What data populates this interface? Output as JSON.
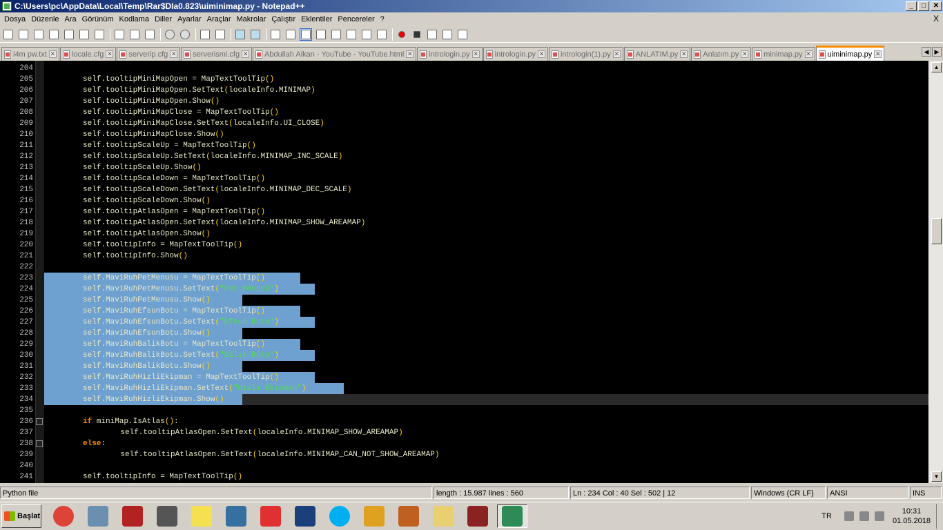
{
  "window": {
    "title": "C:\\Users\\pc\\AppData\\Local\\Temp\\Rar$DIa0.823\\uiminimap.py - Notepad++",
    "buttons": [
      "_",
      "□",
      "✕"
    ]
  },
  "menu": {
    "items": [
      "Dosya",
      "Düzenle",
      "Ara",
      "Görünüm",
      "Kodlama",
      "Diller",
      "Ayarlar",
      "Araçlar",
      "Makrolar",
      "Çalıştır",
      "Eklentiler",
      "Pencereler",
      "?"
    ],
    "close": "X"
  },
  "tabs": [
    {
      "label": "i4m pw.txt",
      "active": false
    },
    {
      "label": "locale.cfg",
      "active": false
    },
    {
      "label": "serverip.cfg",
      "active": false
    },
    {
      "label": "serverismi.cfg",
      "active": false
    },
    {
      "label": "Abdullah Alkan - YouTube - YouTube.html",
      "active": false
    },
    {
      "label": "introlo​gin.py",
      "active": false
    },
    {
      "label": "introlo​gin.py",
      "active": false
    },
    {
      "label": "introlo​gin(1).py",
      "active": false
    },
    {
      "label": "ANLATIM.py",
      "active": false
    },
    {
      "label": "Anlatım.py",
      "active": false
    },
    {
      "label": "minimap.py",
      "active": false
    },
    {
      "label": "uiminimap.py",
      "active": true
    }
  ],
  "editor": {
    "lines": [
      {
        "num": "204",
        "code": ""
      },
      {
        "num": "205",
        "code": "    self.tooltipMiniMapOpen = MapTextToolTip()"
      },
      {
        "num": "206",
        "code": "    self.tooltipMiniMapOpen.SetText(localeInfo.MINIMAP)"
      },
      {
        "num": "207",
        "code": "    self.tooltipMiniMapOpen.Show()"
      },
      {
        "num": "208",
        "code": "    self.tooltipMiniMapClose = MapTextToolTip()"
      },
      {
        "num": "209",
        "code": "    self.tooltipMiniMapClose.SetText(localeInfo.UI_CLOSE)"
      },
      {
        "num": "210",
        "code": "    self.tooltipMiniMapClose.Show()"
      },
      {
        "num": "211",
        "code": "    self.tooltipScaleUp = MapTextToolTip()"
      },
      {
        "num": "212",
        "code": "    self.tooltipScaleUp.SetText(localeInfo.MINIMAP_INC_SCALE)"
      },
      {
        "num": "213",
        "code": "    self.tooltipScaleUp.Show()"
      },
      {
        "num": "214",
        "code": "    self.tooltipScaleDown = MapTextToolTip()"
      },
      {
        "num": "215",
        "code": "    self.tooltipScaleDown.SetText(localeInfo.MINIMAP_DEC_SCALE)"
      },
      {
        "num": "216",
        "code": "    self.tooltipScaleDown.Show()"
      },
      {
        "num": "217",
        "code": "    self.tooltipAtlasOpen = MapTextToolTip()"
      },
      {
        "num": "218",
        "code": "    self.tooltipAtlasOpen.SetText(localeInfo.MINIMAP_SHOW_AREAMAP)"
      },
      {
        "num": "219",
        "code": "    self.tooltipAtlasOpen.Show()"
      },
      {
        "num": "220",
        "code": "    self.tooltipInfo = MapTextToolTip()"
      },
      {
        "num": "221",
        "code": "    self.tooltipInfo.Show()"
      },
      {
        "num": "222",
        "code": ""
      },
      {
        "num": "223",
        "code": "    self.MaviRuhPetMenusu = MapTextToolTip()"
      },
      {
        "num": "224",
        "code": "    self.MaviRuhPetMenusu.SetText(\"Pet Menüsü\")"
      },
      {
        "num": "225",
        "code": "    self.MaviRuhPetMenusu.Show()"
      },
      {
        "num": "226",
        "code": "    self.MaviRuhEfsunBotu = MapTextToolTip()"
      },
      {
        "num": "227",
        "code": "    self.MaviRuhEfsunBotu.SetText(\"Efsun Botu\")"
      },
      {
        "num": "228",
        "code": "    self.MaviRuhEfsunBotu.Show()"
      },
      {
        "num": "229",
        "code": "    self.MaviRuhBalikBotu = MapTextToolTip()"
      },
      {
        "num": "230",
        "code": "    self.MaviRuhBalikBotu.SetText(\"Balık Botu\")"
      },
      {
        "num": "231",
        "code": "    self.MaviRuhBalikBotu.Show()"
      },
      {
        "num": "232",
        "code": "    self.MaviRuhHizliEkipman = MapTextToolTip()"
      },
      {
        "num": "233",
        "code": "    self.MaviRuhHizliEkipman.SetText(\"Hızlı Ekipman\")"
      },
      {
        "num": "234",
        "code": "    self.MaviRuhHizliEkipman.Show()"
      },
      {
        "num": "235",
        "code": ""
      },
      {
        "num": "236",
        "code": "    if miniMap.IsAtlas():"
      },
      {
        "num": "237",
        "code": "        self.tooltipAtlasOpen.SetText(localeInfo.MINIMAP_SHOW_AREAMAP)"
      },
      {
        "num": "238",
        "code": "    else:"
      },
      {
        "num": "239",
        "code": "        self.tooltipAtlasOpen.SetText(localeInfo.MINIMAP_CAN_NOT_SHOW_AREAMAP)"
      },
      {
        "num": "240",
        "code": ""
      },
      {
        "num": "241",
        "code": "    self.tooltipInfo = MapTextToolTip()"
      }
    ]
  },
  "status": {
    "filetype": "Python file",
    "length": "length : 15.987    lines : 560",
    "position": "Ln : 234    Col : 40    Sel : 502 | 12",
    "eol": "Windows (CR LF)",
    "encoding": "ANSI",
    "mode": "INS"
  },
  "taskbar": {
    "start": "Başlat",
    "lang": "TR",
    "time": "10:31",
    "date": "01.05.2018",
    "apps": [
      "chrome-icon",
      "network-icon",
      "filezilla-icon",
      "headset-icon",
      "yellow-app-icon",
      "python-icon",
      "yandex-icon",
      "virtualbox-icon",
      "skype-icon",
      "dragon-icon",
      "mt2-icon",
      "folder-icon",
      "winrar-icon",
      "notepadpp-icon"
    ]
  },
  "colors": {
    "selection": "#6ea0d0",
    "keyword": "#ff8c00",
    "string": "#4ee04e",
    "paren": "#ffd700",
    "active_tab_accent": "#fa8c00"
  }
}
